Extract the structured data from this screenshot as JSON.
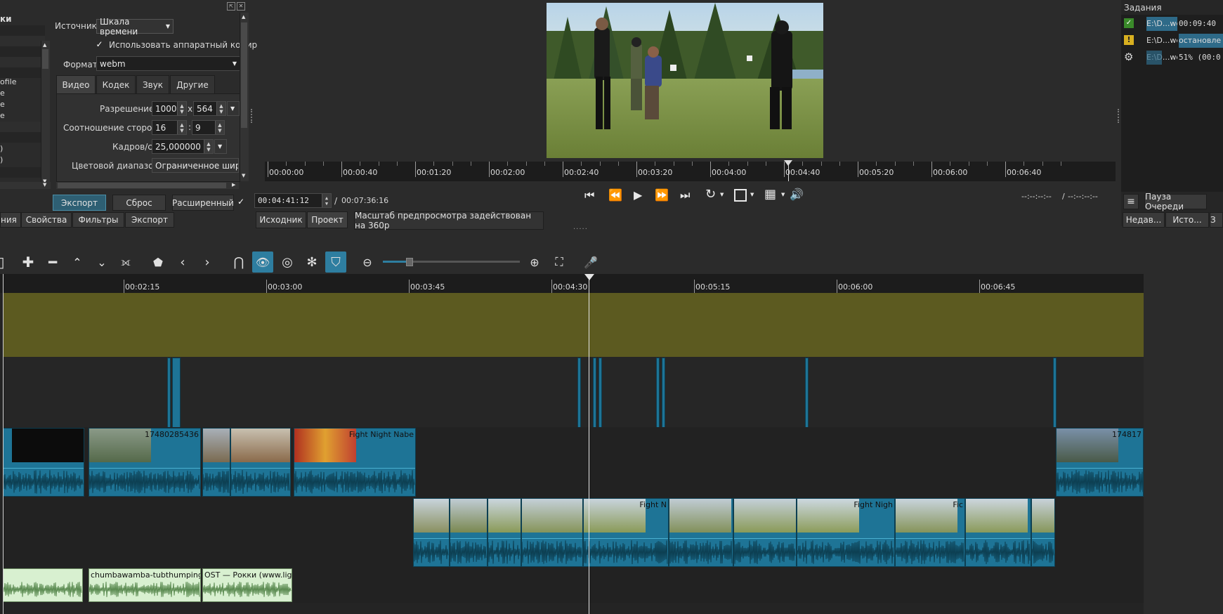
{
  "left_panel": {
    "partial_header": "ки",
    "partial_items": [
      "ofile",
      "e",
      "e",
      "e",
      ")",
      ")"
    ],
    "source_label": "Источник",
    "source_value": "Шкала времени",
    "hw_encode_label": "Использовать аппаратный кодир",
    "format_label": "Формат",
    "format_value": "webm",
    "tabs": [
      "Видео",
      "Кодек",
      "Звук",
      "Другие"
    ],
    "resolution_label": "Разрешение",
    "resolution_w": "1000",
    "resolution_x": "x",
    "resolution_h": "564",
    "aspect_label": "Соотношение сторон",
    "aspect_w": "16",
    "aspect_colon": ":",
    "aspect_h": "9",
    "fps_label": "Кадров/с",
    "fps_value": "25,000000",
    "color_range_label": "Цветовой диапазон",
    "color_range_value": "Ограниченное широ",
    "export_button": "Экспорт",
    "reset_button": "Сброс",
    "advanced_button": "Расширенный",
    "bottom_tabs": [
      "ния",
      "Свойства",
      "Фильтры",
      "Экспорт"
    ]
  },
  "player": {
    "ruler_labels": [
      "00:00:00",
      "00:00:40",
      "00:01:20",
      "00:02:00",
      "00:02:40",
      "00:03:20",
      "00:04:00",
      "00:04:40",
      "00:05:20",
      "00:06:00",
      "00:06:40"
    ],
    "playhead_fraction": 0.615,
    "position": "00:04:41:12",
    "separator": "/",
    "duration": "00:07:36:16",
    "in_out": "--:--:--:--",
    "in_out_sep": "/",
    "in_out_2": "--:--:--:--",
    "tabs": [
      "Исходник",
      "Проект"
    ],
    "status_message": "Масштаб предпросмотра задействован на 360p",
    "dots": "....."
  },
  "jobs": {
    "title": "Задания",
    "rows": [
      {
        "icon": "check-icon",
        "name": "E:\\D...we",
        "status": "00:09:40"
      },
      {
        "icon": "warning-icon",
        "name": "E:\\D...we",
        "status": "остановле"
      },
      {
        "icon": "gear-icon",
        "name": "E:\\D...we",
        "status": "51% (00:0"
      }
    ],
    "menu_button": "≡",
    "pause_button": "Пауза Очереди",
    "bottom_tabs": [
      "Недав...",
      "Исто...",
      "З"
    ]
  },
  "timeline": {
    "ruler_labels": [
      "00:02:15",
      "00:03:00",
      "00:03:45",
      "00:04:30",
      "00:05:15",
      "00:06:00",
      "00:06:45"
    ],
    "clip_titles": {
      "v1_c3": "17480285436",
      "v1_c6": "Fight Night Nabe",
      "v1_c7": "174817",
      "v2_c7": "Fight N",
      "v2_c10": "Fight Nigh",
      "v2_c12": "Fic"
    },
    "audio_titles": [
      "chumbawamba-tubthumping.mp",
      "OST — Рокки (www.lighta"
    ]
  },
  "colors": {
    "accent": "#2e7ea0",
    "clip_blue": "#1e7496",
    "olive_track": "#5c5a20",
    "audio_clip": "#d8f0d0"
  }
}
